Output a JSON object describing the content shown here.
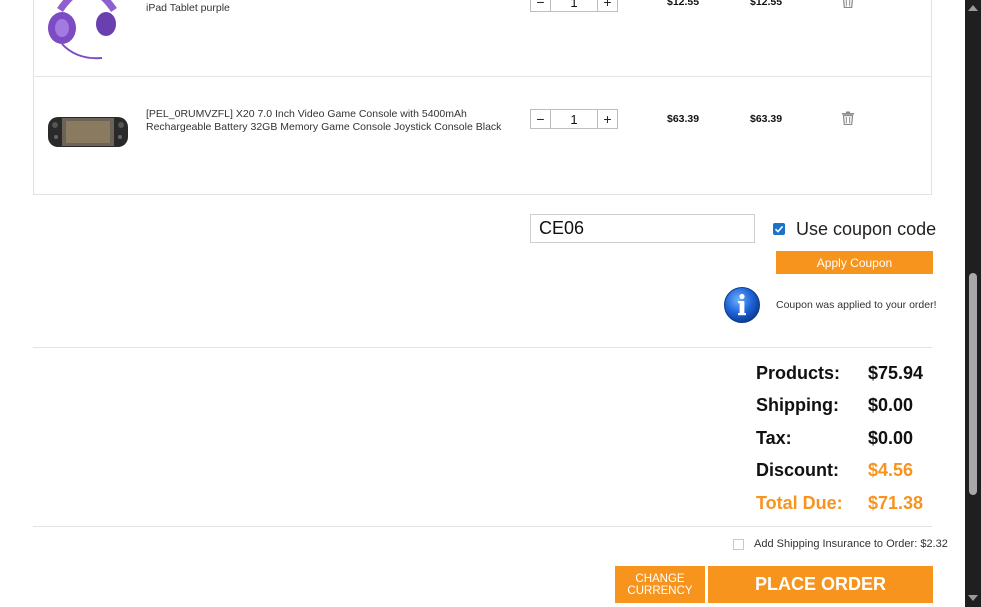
{
  "cart": {
    "items": [
      {
        "name": "iPad Tablet purple",
        "quantity": "1",
        "unit_price": "$12.55",
        "total_price": "$12.55"
      },
      {
        "name": "[PEL_0RUMVZFL] X20 7.0 Inch Video Game Console with 5400mAh Rechargeable Battery 32GB Memory Game Console Joystick Console Black",
        "quantity": "1",
        "unit_price": "$63.39",
        "total_price": "$63.39"
      }
    ],
    "minus_symbol": "−",
    "plus_symbol": "+"
  },
  "coupon": {
    "code": "CE06",
    "use_label": "Use coupon code",
    "checked": true,
    "apply_label": "Apply Coupon",
    "message": "Coupon was applied to your order!"
  },
  "totals": {
    "products_label": "Products:",
    "products_value": "$75.94",
    "shipping_label": "Shipping:",
    "shipping_value": "$0.00",
    "tax_label": "Tax:",
    "tax_value": "$0.00",
    "discount_label": "Discount:",
    "discount_value": "$4.56",
    "total_label": "Total Due:",
    "total_value": "$71.38"
  },
  "insurance": {
    "label": "Add Shipping Insurance to Order: $2.32",
    "checked": false
  },
  "actions": {
    "change_currency_line1": "CHANGE",
    "change_currency_line2": "CURRENCY",
    "place_order": "PLACE ORDER"
  },
  "colors": {
    "accent": "#f7941d",
    "checkbox": "#1a73c9",
    "scrollbar_track": "#1f1f1f"
  }
}
